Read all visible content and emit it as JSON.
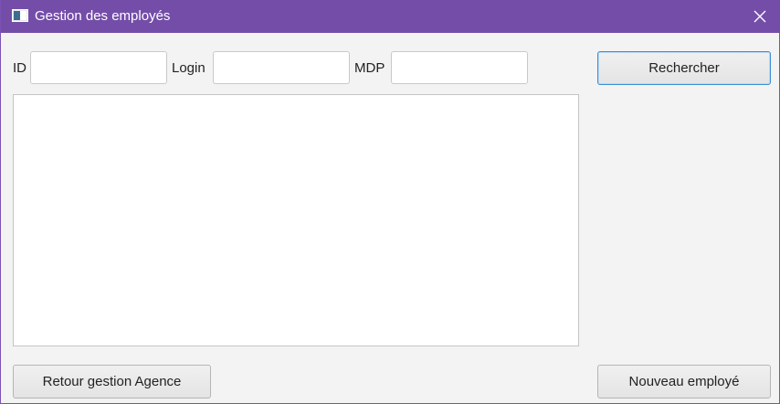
{
  "window": {
    "title": "Gestion des employés"
  },
  "form": {
    "id_label": "ID",
    "id_value": "",
    "login_label": "Login",
    "login_value": "",
    "mdp_label": "MDP",
    "mdp_value": ""
  },
  "buttons": {
    "search": "Rechercher",
    "back": "Retour gestion Agence",
    "new_employee": "Nouveau employé"
  },
  "icons": {
    "app": "window-app-icon",
    "close": "close-icon"
  },
  "colors": {
    "titlebar": "#744da9",
    "focus_border": "#3a8fd6"
  }
}
